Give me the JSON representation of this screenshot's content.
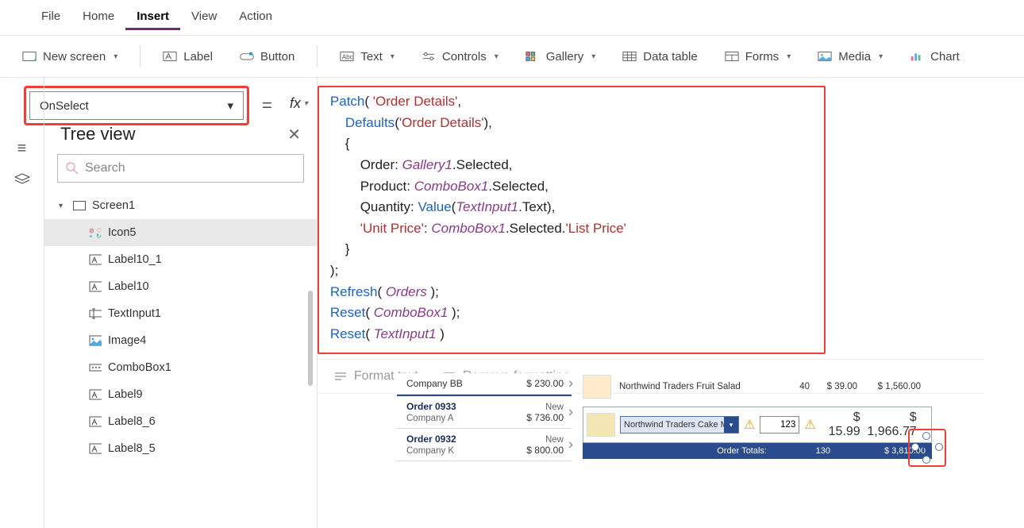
{
  "menu": {
    "items": [
      "File",
      "Home",
      "Insert",
      "View",
      "Action"
    ],
    "active": "Insert"
  },
  "ribbon": {
    "new_screen": "New screen",
    "label": "Label",
    "button": "Button",
    "text": "Text",
    "controls": "Controls",
    "gallery": "Gallery",
    "datatable": "Data table",
    "forms": "Forms",
    "media": "Media",
    "chart": "Chart"
  },
  "property": {
    "name": "OnSelect"
  },
  "formula": {
    "l1a": "Patch",
    "l1b": "( ",
    "l1c": "'Order Details'",
    "l1d": ",",
    "l2a": "    ",
    "l2b": "Defaults",
    "l2c": "(",
    "l2d": "'Order Details'",
    "l2e": "),",
    "l3": "    {",
    "l4a": "        Order: ",
    "l4b": "Gallery1",
    "l4c": ".Selected,",
    "l5a": "        Product: ",
    "l5b": "ComboBox1",
    "l5c": ".Selected,",
    "l6a": "        Quantity: ",
    "l6b": "Value",
    "l6c": "(",
    "l6d": "TextInput1",
    "l6e": ".Text),",
    "l7a": "        ",
    "l7b": "'Unit Price'",
    "l7c": ": ",
    "l7d": "ComboBox1",
    "l7e": ".Selected.",
    "l7f": "'List Price'",
    "l8": "    }",
    "l9": ");",
    "l10a": "Refresh",
    "l10b": "( ",
    "l10c": "Orders",
    "l10d": " );",
    "l11a": "Reset",
    "l11b": "( ",
    "l11c": "ComboBox1",
    "l11d": " );",
    "l12a": "Reset",
    "l12b": "( ",
    "l12c": "TextInput1",
    "l12d": " )"
  },
  "fmt": {
    "format": "Format text",
    "remove": "Remove formatting"
  },
  "tree": {
    "title": "Tree view",
    "search_placeholder": "Search",
    "screen": "Screen1",
    "items": [
      {
        "name": "Icon5",
        "kind": "icon5",
        "sel": true
      },
      {
        "name": "Label10_1",
        "kind": "label"
      },
      {
        "name": "Label10",
        "kind": "label"
      },
      {
        "name": "TextInput1",
        "kind": "textinput"
      },
      {
        "name": "Image4",
        "kind": "image"
      },
      {
        "name": "ComboBox1",
        "kind": "combo"
      },
      {
        "name": "Label9",
        "kind": "label"
      },
      {
        "name": "Label8_6",
        "kind": "label"
      },
      {
        "name": "Label8_5",
        "kind": "label"
      }
    ]
  },
  "orders": [
    {
      "company": "Company BB",
      "amount": "$ 230.00",
      "status": ""
    },
    {
      "order": "Order 0933",
      "company": "Company A",
      "amount": "$ 736.00",
      "status": "New"
    },
    {
      "order": "Order 0932",
      "company": "Company K",
      "amount": "$ 800.00",
      "status": "New"
    }
  ],
  "product_row": {
    "name": "Northwind Traders Fruit Salad",
    "qty": "40",
    "price": "$ 39.00",
    "total": "$ 1,560.00"
  },
  "edit_row": {
    "combo_value": "Northwind Traders Cake Mix",
    "qty": "123",
    "price": "$ 15.99",
    "linetotal": "$ 1,966.77"
  },
  "totals": {
    "label": "Order Totals:",
    "qty": "130",
    "sum": "$ 3,810.00"
  }
}
